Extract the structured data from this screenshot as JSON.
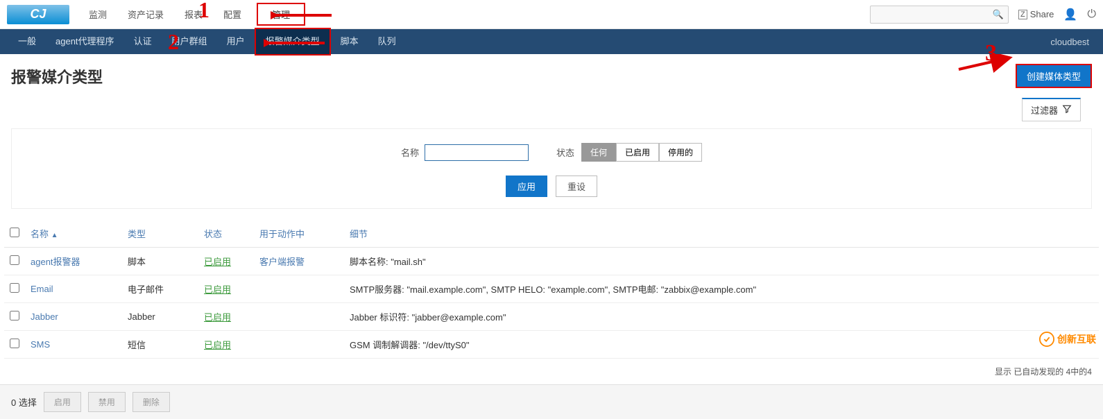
{
  "topnav": {
    "items": [
      "监测",
      "资产记录",
      "报表",
      "配置",
      "管理"
    ],
    "active_index": 4,
    "share": "Share",
    "share_prefix": "Z"
  },
  "subnav": {
    "items": [
      "一般",
      "agent代理程序",
      "认证",
      "用户群组",
      "用户",
      "报警媒介类型",
      "脚本",
      "队列"
    ],
    "active_index": 5,
    "right_user": "cloudbest"
  },
  "page": {
    "title": "报警媒介类型",
    "create_btn": "创建媒体类型",
    "filter_tab": "过滤器"
  },
  "filter": {
    "name_label": "名称",
    "name_value": "",
    "status_label": "状态",
    "status_options": [
      "任何",
      "已启用",
      "停用的"
    ],
    "status_active": 0,
    "apply": "应用",
    "reset": "重设"
  },
  "table": {
    "headers": {
      "name": "名称",
      "type": "类型",
      "status": "状态",
      "used_in": "用于动作中",
      "details": "细节"
    },
    "sort_indicator": "▲",
    "rows": [
      {
        "name": "agent报警器",
        "type": "脚本",
        "status": "已启用",
        "used_in": "客户端报警",
        "details": "脚本名称: \"mail.sh\""
      },
      {
        "name": "Email",
        "type": "电子邮件",
        "status": "已启用",
        "used_in": "",
        "details": "SMTP服务器: \"mail.example.com\", SMTP HELO: \"example.com\", SMTP电邮: \"zabbix@example.com\""
      },
      {
        "name": "Jabber",
        "type": "Jabber",
        "status": "已启用",
        "used_in": "",
        "details": "Jabber 标识符: \"jabber@example.com\""
      },
      {
        "name": "SMS",
        "type": "短信",
        "status": "已启用",
        "used_in": "",
        "details": "GSM 调制解调器: \"/dev/ttyS0\""
      }
    ]
  },
  "footer": {
    "summary": "显示 已自动发现的 4中的4"
  },
  "bulk": {
    "selected_count": "0 选择",
    "enable": "启用",
    "disable": "禁用",
    "delete": "删除"
  },
  "annotations": {
    "one": "1",
    "two": "2",
    "three": "3"
  },
  "watermark": {
    "text": "创新互联"
  },
  "icons": {
    "search": "🔍",
    "user": "👤",
    "power": "⏻",
    "filter": "▽"
  }
}
